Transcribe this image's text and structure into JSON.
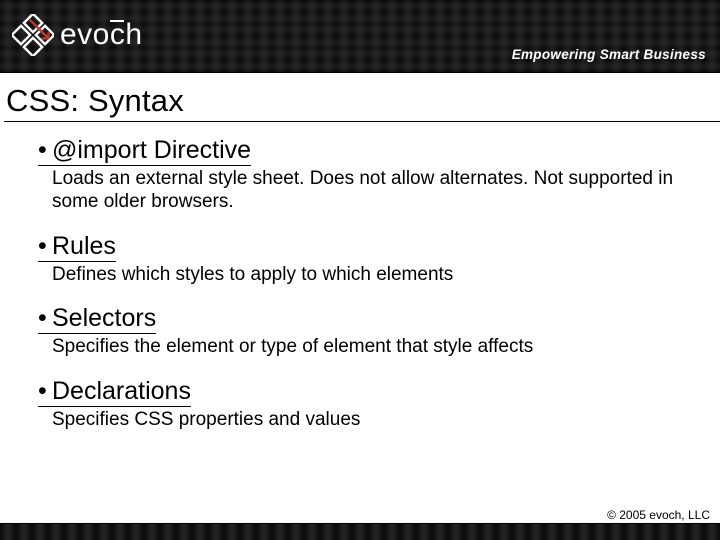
{
  "brand": {
    "name": "evoch",
    "tagline": "Empowering Smart Business",
    "accent": "#c0392b"
  },
  "slide": {
    "title": "CSS: Syntax",
    "items": [
      {
        "heading": "@import Directive",
        "desc": "Loads an external style sheet.  Does not allow alternates. Not supported in some older browsers."
      },
      {
        "heading": "Rules",
        "desc": "Defines which styles to apply to which elements"
      },
      {
        "heading": "Selectors",
        "desc": "Specifies the element or type of element that style affects"
      },
      {
        "heading": "Declarations",
        "desc": "Specifies CSS properties and values"
      }
    ]
  },
  "footer": {
    "copyright": "© 2005  evoch, LLC"
  }
}
